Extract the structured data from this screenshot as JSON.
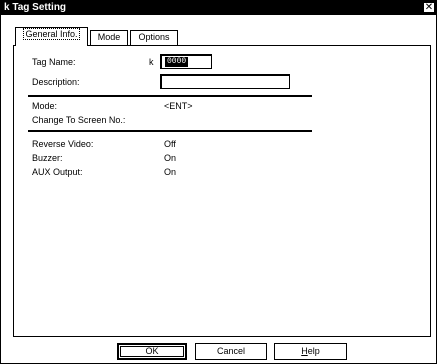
{
  "window": {
    "title": "k Tag Setting",
    "close_glyph": "✕"
  },
  "tabs": [
    {
      "label": "General Info."
    },
    {
      "label": "Mode"
    },
    {
      "label": "Options"
    }
  ],
  "general": {
    "tag_name_label": "Tag Name:",
    "tag_prefix": "k",
    "tag_name_value": "0000",
    "description_label": "Description:",
    "description_value": "",
    "mode_label": "Mode:",
    "mode_value": "<ENT>",
    "change_screen_label": "Change To Screen No.:",
    "change_screen_value": "",
    "reverse_video_label": "Reverse Video:",
    "reverse_video_value": "Off",
    "buzzer_label": "Buzzer:",
    "buzzer_value": "On",
    "aux_output_label": "AUX Output:",
    "aux_output_value": "On"
  },
  "buttons": {
    "ok": "OK",
    "cancel": "Cancel",
    "help_first": "H",
    "help_rest": "elp"
  }
}
